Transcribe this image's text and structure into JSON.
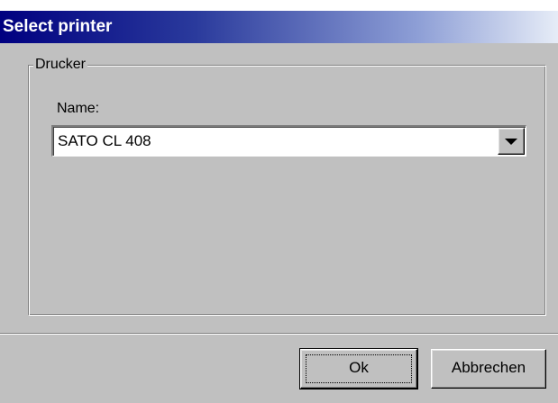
{
  "window": {
    "title": "Select printer"
  },
  "group": {
    "legend": "Drucker",
    "name_label": "Name:",
    "printer_select": {
      "value": "SATO CL 408"
    }
  },
  "buttons": {
    "ok_label": "Ok",
    "cancel_label": "Abbrechen"
  },
  "icons": {
    "dropdown": "chevron-down-icon"
  },
  "colors": {
    "titlebar_start": "#000080",
    "titlebar_end": "#e6ecf7",
    "face": "#c0c0c0"
  }
}
